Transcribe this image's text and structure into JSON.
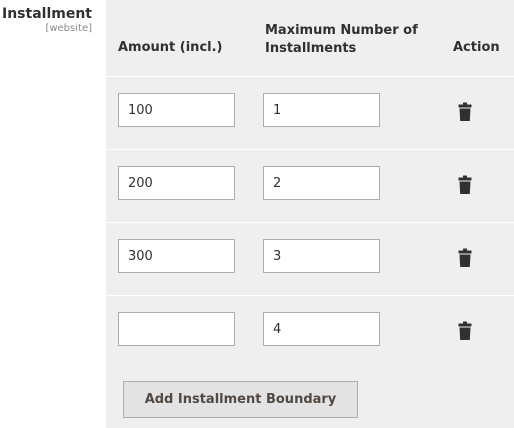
{
  "field": {
    "label": "Installment",
    "scope": "[website]"
  },
  "columns": {
    "amount": "Amount (incl.)",
    "max_installments": "Maximum Number of Installments",
    "action": "Action"
  },
  "rows": [
    {
      "amount": "100",
      "max_installments": "1"
    },
    {
      "amount": "200",
      "max_installments": "2"
    },
    {
      "amount": "300",
      "max_installments": "3"
    },
    {
      "amount": "",
      "max_installments": "4"
    }
  ],
  "add_button_label": "Add Installment Boundary",
  "icons": {
    "delete": "trash-icon"
  }
}
